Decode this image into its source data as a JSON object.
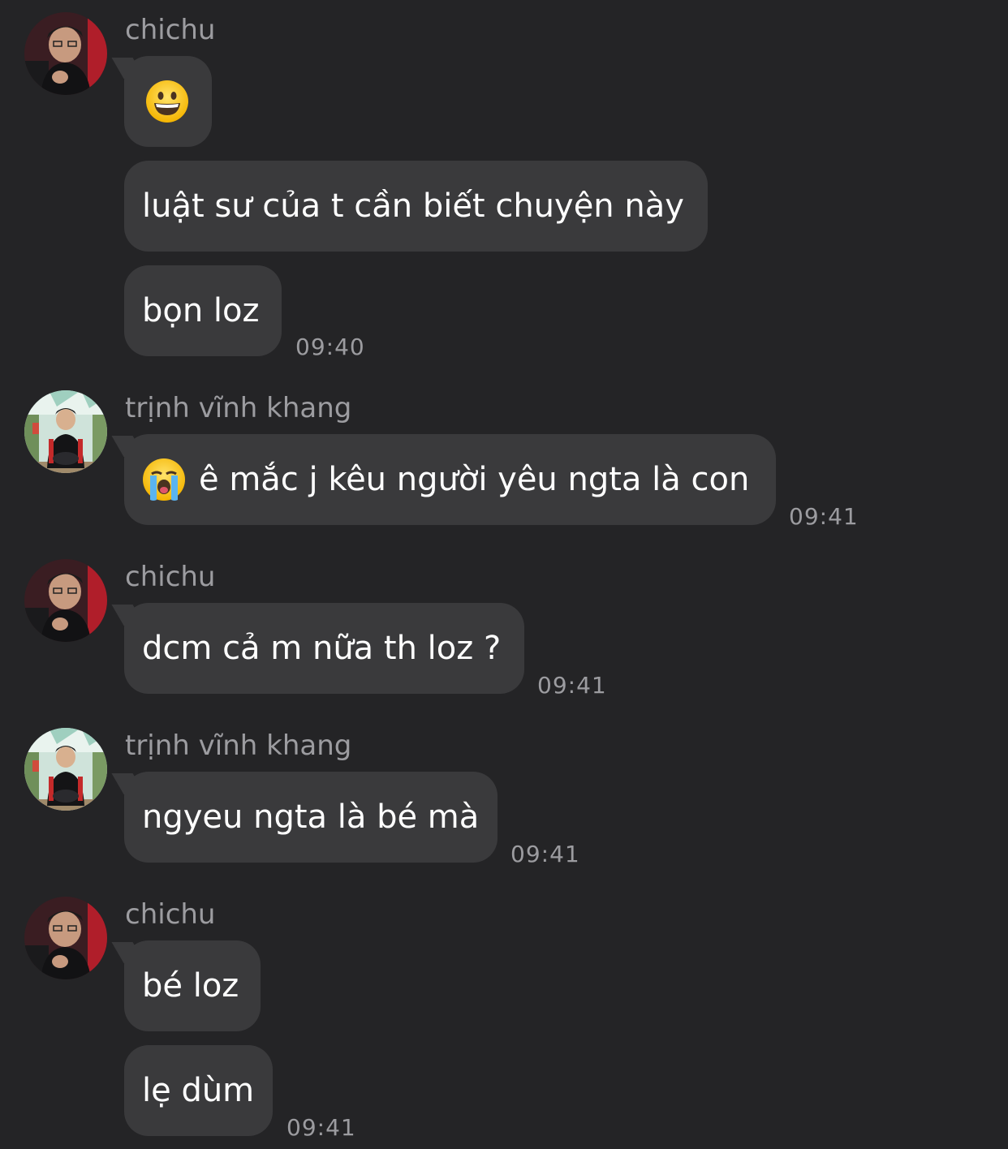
{
  "messages": [
    {
      "sender": "chichu",
      "bubbles": [
        {
          "emoji": "grinning-face",
          "text": ""
        },
        {
          "text": "luật sư của t cần biết chuyện này"
        },
        {
          "text": "bọn loz"
        }
      ],
      "time": "09:40"
    },
    {
      "sender": "trịnh vĩnh khang",
      "bubbles": [
        {
          "emoji": "crying-face",
          "text": "ê mắc j kêu người yêu ngta là con"
        }
      ],
      "time": "09:41"
    },
    {
      "sender": "chichu",
      "bubbles": [
        {
          "text": "dcm cả m nữa th loz ?"
        }
      ],
      "time": "09:41"
    },
    {
      "sender": "trịnh vĩnh khang",
      "bubbles": [
        {
          "text": "ngyeu ngta là bé mà"
        }
      ],
      "time": "09:41"
    },
    {
      "sender": "chichu",
      "bubbles": [
        {
          "text": "bé loz"
        },
        {
          "text": "lẹ dùm"
        }
      ],
      "time": "09:41"
    }
  ],
  "colors": {
    "background": "#242426",
    "bubble": "#3a3a3c",
    "secondary_text": "#9c9ca0",
    "primary_text": "#ffffff"
  }
}
